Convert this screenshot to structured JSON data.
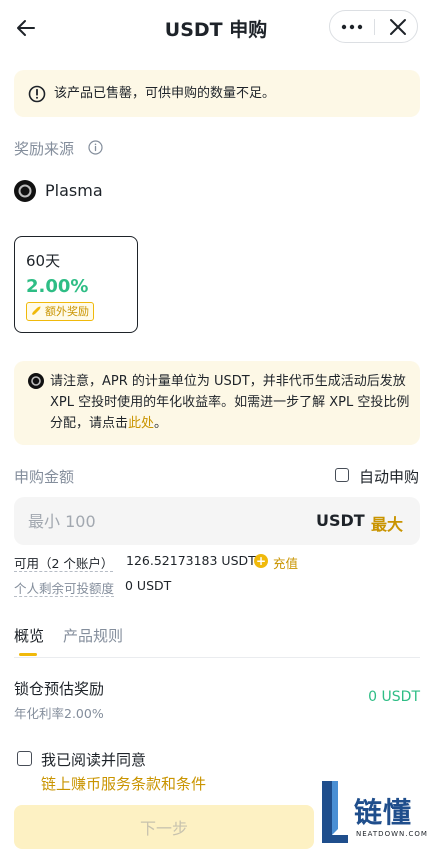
{
  "header": {
    "title": "USDT 申购",
    "back_icon": "arrow-left-icon",
    "more_icon": "more-dots-icon",
    "close_icon": "close-icon"
  },
  "alert": {
    "icon": "warning-circle-icon",
    "text": "该产品已售罄，可供申购的数量不足。"
  },
  "reward_source": {
    "label": "奖励来源",
    "info_icon": "info-icon",
    "name": "Plasma"
  },
  "product_card": {
    "days": "60天",
    "rate": "2.00%",
    "badge": "额外奖励"
  },
  "notice": {
    "text_prefix": "请注意，APR 的计量单位为 USDT，并非代币生成活动后发放 XPL 空投时使用的年化收益率。如需进一步了解 XPL 空投比例分配，请点击",
    "link": "此处",
    "text_suffix": "。"
  },
  "subscribe": {
    "label": "申购金额",
    "auto_label": "自动申购",
    "placeholder": "最小 100",
    "unit": "USDT",
    "max": "最大"
  },
  "available": {
    "label": "可用（2 个账户）",
    "value": "126.52173183 USDT",
    "recharge": "充值"
  },
  "remaining": {
    "label": "个人剩余可投额度",
    "value": "0 USDT"
  },
  "tabs": [
    {
      "label": "概览"
    },
    {
      "label": "产品规则"
    }
  ],
  "lock": {
    "title": "锁仓预估奖励",
    "sub": "年化利率2.00%",
    "value": "0 USDT"
  },
  "agreement": {
    "label": "我已阅读并同意",
    "terms": "链上赚币服务条款和条件"
  },
  "next_button": "下一步",
  "watermark": {
    "cn": "链懂",
    "en": "NEATDOWN.COM"
  },
  "colors": {
    "accent": "#f0b90b",
    "green": "#2ebd85",
    "alert_bg": "#fdf8e6"
  }
}
